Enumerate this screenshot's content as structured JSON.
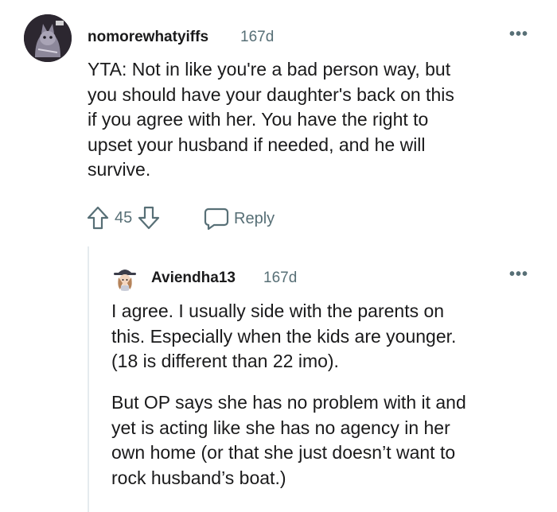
{
  "comment": {
    "username": "nomorewhatyiffs",
    "age": "167d",
    "more": "•••",
    "lines": [
      "YTA: Not in like you're a bad person way, but",
      "you should have your daughter's back on this",
      "if you agree with her. You have the right to",
      "upset your husband if needed, and he will",
      "survive."
    ],
    "votes": "45",
    "reply_label": "Reply"
  },
  "reply": {
    "username": "Aviendha13",
    "age": "167d",
    "more": "•••",
    "paragraph1": [
      "I agree. I usually side with the parents on",
      "this. Especially when the kids are younger.",
      "(18 is different than 22 imo)."
    ],
    "paragraph2": [
      "But OP says she has no problem with it and",
      "yet is acting like she has no agency in her",
      "own home (or that she just doesn’t want to",
      "rock husband’s boat.)"
    ]
  },
  "colors": {
    "text": "#1a1a1b",
    "meta": "#576f76",
    "thread_line": "#e5ebee"
  }
}
